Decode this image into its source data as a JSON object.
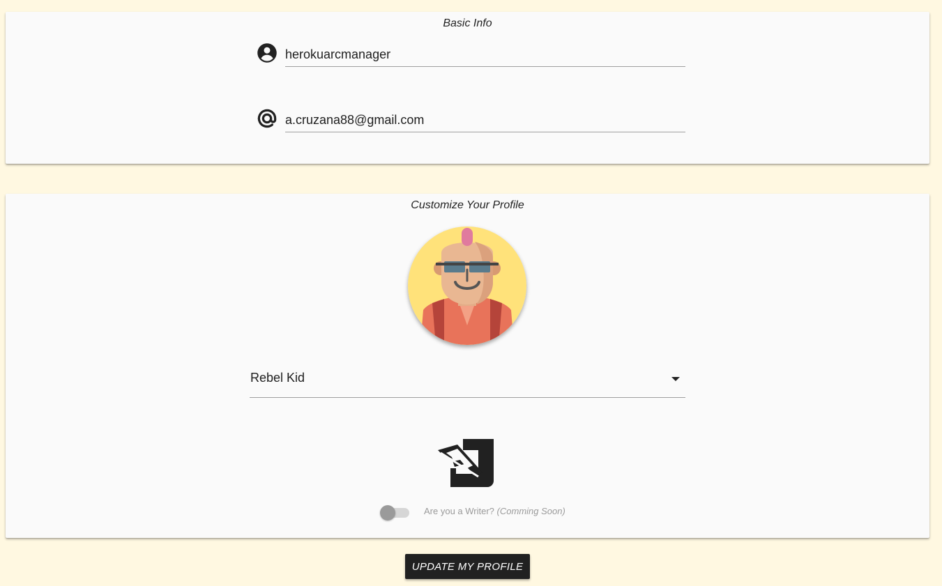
{
  "basic_info": {
    "title": "Basic Info",
    "username": {
      "value": "herokuarcmanager",
      "icon": "account-circle-icon"
    },
    "email": {
      "value": "a.cruzana88@gmail.com",
      "icon": "at-sign-icon"
    }
  },
  "customize": {
    "title": "Customize Your Profile",
    "avatar": {
      "selected": "Rebel Kid",
      "icon": "rebel-kid-avatar"
    },
    "writer": {
      "icon": "writer-feather-icon",
      "label": "Are you a Writer?",
      "note": "(Comming Soon)",
      "enabled": false
    }
  },
  "actions": {
    "update_label": "UPDATE MY PROFILE"
  },
  "colors": {
    "background": "#fff8e1",
    "card": "#fafafa",
    "button": "#212121",
    "avatar_bg": "#ffe27a",
    "shirt": "#e8735a"
  }
}
